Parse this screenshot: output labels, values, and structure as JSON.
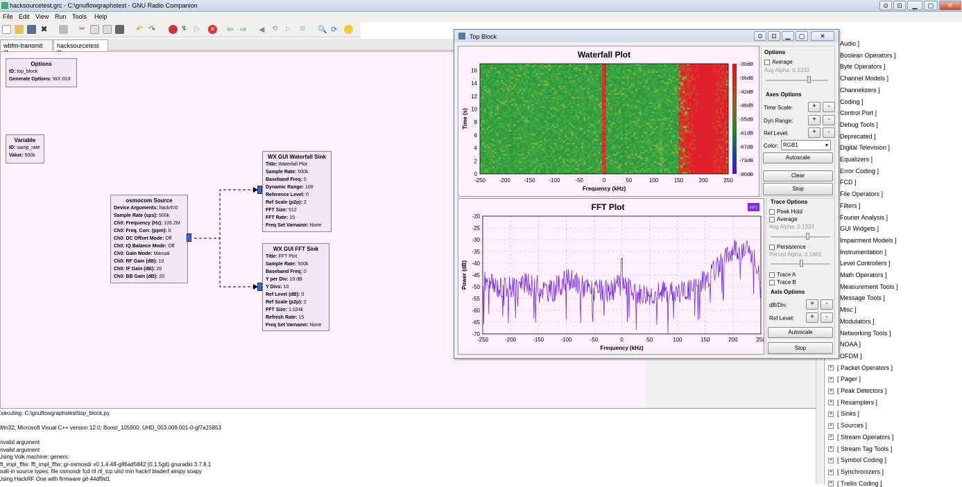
{
  "window": {
    "title": "hacksourcetest.grc - C:\\gnuflowgraphstest - GNU Radio Companion"
  },
  "menu": [
    "File",
    "Edit",
    "View",
    "Run",
    "Tools",
    "Help"
  ],
  "tabs": [
    {
      "label": "wbfm-transmit"
    },
    {
      "label": "hacksourcetest"
    }
  ],
  "blocks": {
    "options": {
      "title": "Options",
      "rows": [
        [
          "ID:",
          "top_block"
        ],
        [
          "Generate Options:",
          "WX GUI"
        ]
      ]
    },
    "variable": {
      "title": "Variable",
      "rows": [
        [
          "ID:",
          "samp_rate"
        ],
        [
          "Value:",
          "500k"
        ]
      ]
    },
    "source": {
      "title": "osmocom Source",
      "rows": [
        [
          "Device Arguments:",
          "hackrf=0"
        ],
        [
          "Sample Rate (sps):",
          "500k"
        ],
        [
          "Ch0: Frequency (Hz):",
          "105.2M"
        ],
        [
          "Ch0: Freq. Corr. (ppm):",
          "0"
        ],
        [
          "Ch0: DC Offset Mode:",
          "Off"
        ],
        [
          "Ch0: IQ Balance Mode:",
          "Off"
        ],
        [
          "Ch0: Gain Mode:",
          "Manual"
        ],
        [
          "Ch0: RF Gain (dB):",
          "10"
        ],
        [
          "Ch0: IF Gain (dB):",
          "20"
        ],
        [
          "Ch0: BB Gain (dB):",
          "20"
        ]
      ]
    },
    "waterfall": {
      "title": "WX GUI Waterfall Sink",
      "rows": [
        [
          "Title:",
          "Waterfall Plot"
        ],
        [
          "Sample Rate:",
          "500k"
        ],
        [
          "Baseband Freq:",
          "0"
        ],
        [
          "Dynamic Range:",
          "100"
        ],
        [
          "Reference Level:",
          "0"
        ],
        [
          "Ref Scale (p2p):",
          "2"
        ],
        [
          "FFT Size:",
          "512"
        ],
        [
          "FFT Rate:",
          "15"
        ],
        [
          "Freq Set Varname:",
          "None"
        ]
      ]
    },
    "fft": {
      "title": "WX GUI FFT Sink",
      "rows": [
        [
          "Title:",
          "FFT Plot"
        ],
        [
          "Sample Rate:",
          "500k"
        ],
        [
          "Baseband Freq:",
          "0"
        ],
        [
          "Y per Div:",
          "10 dB"
        ],
        [
          "Y Divs:",
          "10"
        ],
        [
          "Ref Level (dB):",
          "0"
        ],
        [
          "Ref Scale (p2p):",
          "2"
        ],
        [
          "FFT Size:",
          "1.024k"
        ],
        [
          "Refresh Rate:",
          "15"
        ],
        [
          "Freq Set Varname:",
          "None"
        ]
      ]
    }
  },
  "log": [
    "Executing: C:\\gnuflowgraphstest\\top_block.py",
    "",
    "Win32; Microsoft Visual C++ version 12.0; Boost_105900; UHD_003.009.001-0-gf7a15853",
    "",
    "Invalid argument",
    "Invalid argument",
    "Using Volk machine: generic",
    "fft_impl_fftw: fft_impl_fftw: gr-osmosdr v0.1.4-48-g86ad5842 (0.1.5git) gnuradio 3.7.8.1",
    "built-in source types: file osmosdr fcd rtl rtl_tcp uhd miri hackrf bladerf airspy soapy",
    "Using HackRF One with firmware git-44df9d1"
  ],
  "library": [
    {
      "label": "Audio ]",
      "exp": false
    },
    {
      "label": "Boolean Operators ]",
      "exp": false
    },
    {
      "label": "Byte Operators ]",
      "exp": false
    },
    {
      "label": "Channel Models ]",
      "exp": false
    },
    {
      "label": "Channelizers ]",
      "exp": false
    },
    {
      "label": "Coding ]",
      "exp": false
    },
    {
      "label": "Control Port ]",
      "exp": false
    },
    {
      "label": "Debug Tools ]",
      "exp": false
    },
    {
      "label": "Deprecated ]",
      "exp": false
    },
    {
      "label": "Digital Television ]",
      "exp": false
    },
    {
      "label": "Equalizers ]",
      "exp": false
    },
    {
      "label": "Error Coding ]",
      "exp": false
    },
    {
      "label": "FCD ]",
      "exp": false
    },
    {
      "label": "File Operators ]",
      "exp": false
    },
    {
      "label": "Filters ]",
      "exp": false
    },
    {
      "label": "Fourier Analysis ]",
      "exp": false
    },
    {
      "label": "GUI Widgets ]",
      "exp": false
    },
    {
      "label": "Impairment Models ]",
      "exp": false
    },
    {
      "label": "Instrumentation ]",
      "exp": false
    },
    {
      "label": "Level Controllers ]",
      "exp": false
    },
    {
      "label": "Math Operators ]",
      "exp": false
    },
    {
      "label": "Measurement Tools ]",
      "exp": false
    },
    {
      "label": "Message Tools ]",
      "exp": false
    },
    {
      "label": "Misc ]",
      "exp": false
    },
    {
      "label": "Modulators ]",
      "exp": false
    },
    {
      "label": "Networking Tools ]",
      "exp": false
    },
    {
      "label": "NOAA ]",
      "exp": false
    },
    {
      "label": "OFDM ]",
      "exp": false
    },
    {
      "label": "[ Packet Operators ]",
      "exp": true
    },
    {
      "label": "[ Pager ]",
      "exp": true
    },
    {
      "label": "[ Peak Detectors ]",
      "exp": true
    },
    {
      "label": "[ Resamplers ]",
      "exp": true
    },
    {
      "label": "[ Sinks ]",
      "exp": true
    },
    {
      "label": "[ Sources ]",
      "exp": true
    },
    {
      "label": "[ Stream Operators ]",
      "exp": true
    },
    {
      "label": "[ Stream Tag Tools ]",
      "exp": true
    },
    {
      "label": "[ Symbol Coding ]",
      "exp": true
    },
    {
      "label": "[ Synchronizers ]",
      "exp": true
    },
    {
      "label": "[ Trellis Coding ]",
      "exp": true
    }
  ],
  "topblock": {
    "title": "Top Block",
    "waterfall": {
      "title": "Waterfall Plot",
      "xlabel": "Frequency (kHz)",
      "ylabel": "Time (s)",
      "xticks": [
        "-250",
        "-200",
        "-150",
        "-100",
        "-50",
        "0",
        "50",
        "100",
        "150",
        "200",
        "250"
      ],
      "yticks": [
        "0",
        "2",
        "4",
        "6",
        "8",
        "10",
        "12",
        "14",
        "16"
      ],
      "colorbar": [
        "-30dB",
        "-36dB",
        "-42dB",
        "-48dB",
        "-55dB",
        "-61dB",
        "-67dB",
        "-73dB",
        "-80dB"
      ],
      "options": {
        "header": "Options",
        "average": "Average",
        "avg_alpha": "Avg Alpha: 0.1333",
        "axes_header": "Axes Options",
        "time_scale": "Time Scale:",
        "dyn_range": "Dyn Range:",
        "ref_level": "Ref Level:",
        "color": "Color:",
        "color_value": "RGB1",
        "autoscale": "Autoscale",
        "clear": "Clear",
        "stop": "Stop"
      }
    },
    "fft": {
      "title": "FFT Plot",
      "legend": "FFT",
      "xlabel": "Frequency (kHz)",
      "ylabel": "Power (dB)",
      "xticks": [
        "-250",
        "-200",
        "-150",
        "-100",
        "-50",
        "0",
        "50",
        "100",
        "150",
        "200",
        "250"
      ],
      "yticks": [
        "-20",
        "-25",
        "-30",
        "-35",
        "-40",
        "-45",
        "-50",
        "-55",
        "-60",
        "-65",
        "-70"
      ],
      "options": {
        "trace_header": "Trace Options",
        "peak_hold": "Peak Hold",
        "average": "Average",
        "avg_alpha": "Avg Alpha: 0.1333",
        "persistence": "Persistence",
        "persist_alpha": "Persist Alpha: 0.1861",
        "trace_a": "Trace A",
        "trace_b": "Trace B",
        "axis_header": "Axis Options",
        "db_div": "dB/Div:",
        "ref_level": "Ref Level:",
        "autoscale": "Autoscale",
        "stop": "Stop"
      }
    }
  },
  "chart_data": [
    {
      "type": "heatmap",
      "title": "Waterfall Plot",
      "xlabel": "Frequency (kHz)",
      "ylabel": "Time (s)",
      "xlim": [
        -250,
        250
      ],
      "ylim": [
        0,
        17
      ],
      "zlim_db": [
        -80,
        -30
      ],
      "colormap": "RGB1",
      "features": [
        {
          "x": 0,
          "level": "high"
        },
        {
          "x_range": [
            150,
            250
          ],
          "level": "high"
        }
      ]
    },
    {
      "type": "line",
      "title": "FFT Plot",
      "xlabel": "Frequency (kHz)",
      "ylabel": "Power (dB)",
      "xlim": [
        -250,
        250
      ],
      "ylim": [
        -70,
        -20
      ],
      "series": [
        {
          "name": "FFT",
          "color": "#7a2ddc",
          "x": [
            -250,
            -225,
            -200,
            -175,
            -150,
            -125,
            -100,
            -75,
            -50,
            -25,
            0,
            25,
            50,
            75,
            100,
            125,
            150,
            165,
            175,
            185,
            195,
            205,
            215,
            225,
            235,
            245,
            250
          ],
          "y": [
            -48,
            -50,
            -50,
            -49,
            -50,
            -52,
            -47,
            -49,
            -52,
            -52,
            -49,
            -53,
            -53,
            -52,
            -52,
            -51,
            -47,
            -43,
            -41,
            -39,
            -35,
            -33,
            -35,
            -34,
            -38,
            -42,
            -45
          ]
        }
      ]
    }
  ]
}
